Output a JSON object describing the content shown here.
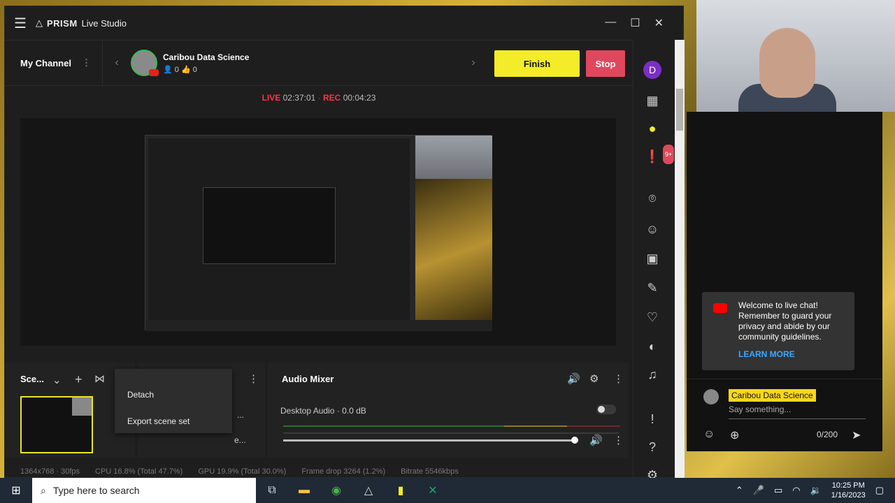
{
  "app": {
    "title": "PRISM Live Studio",
    "brand_bold": "PRISM",
    "brand_rest": "Live Studio"
  },
  "channel": {
    "my_channel": "My Channel",
    "name": "Caribou Data Science",
    "viewers": "0",
    "likes": "0"
  },
  "buttons": {
    "finish": "Finish",
    "stop": "Stop"
  },
  "status": {
    "live_label": "LIVE",
    "live_time": "02:37:01",
    "rec_label": "REC",
    "rec_time": "00:04:23"
  },
  "sidebar": {
    "profile_letter": "D",
    "badge": "9+"
  },
  "scenes": {
    "title": "Sce..."
  },
  "context_menu": {
    "items": [
      "Detach",
      "Export scene set"
    ]
  },
  "mixer": {
    "title": "Audio Mixer",
    "source": "Desktop Audio",
    "level": "0.0 dB"
  },
  "partial_texts": {
    "a": "...",
    "b": "e..."
  },
  "statusbar": {
    "resolution": "1364x768 · 30fps",
    "cpu": "CPU 16.8% (Total 47.7%)",
    "gpu": "GPU 19.9% (Total 30.0%)",
    "frame_drop": "Frame drop 3264 (1.2%)",
    "bitrate": "Bitrate 5546kbps"
  },
  "chat": {
    "welcome": "Welcome to live chat! Remember to guard your privacy and abide by our community guidelines.",
    "learn_more": "LEARN MORE",
    "user": "Caribou Data Science",
    "placeholder": "Say something...",
    "counter": "0/200"
  },
  "taskbar": {
    "search": "Type here to search",
    "time": "10:25 PM",
    "date": "1/16/2023"
  },
  "colors": {
    "finish": "#f4ec28",
    "stop": "#e0475c",
    "live": "#ff3344",
    "accent": "#7b2fc4",
    "learn_more": "#3ea6ff"
  }
}
